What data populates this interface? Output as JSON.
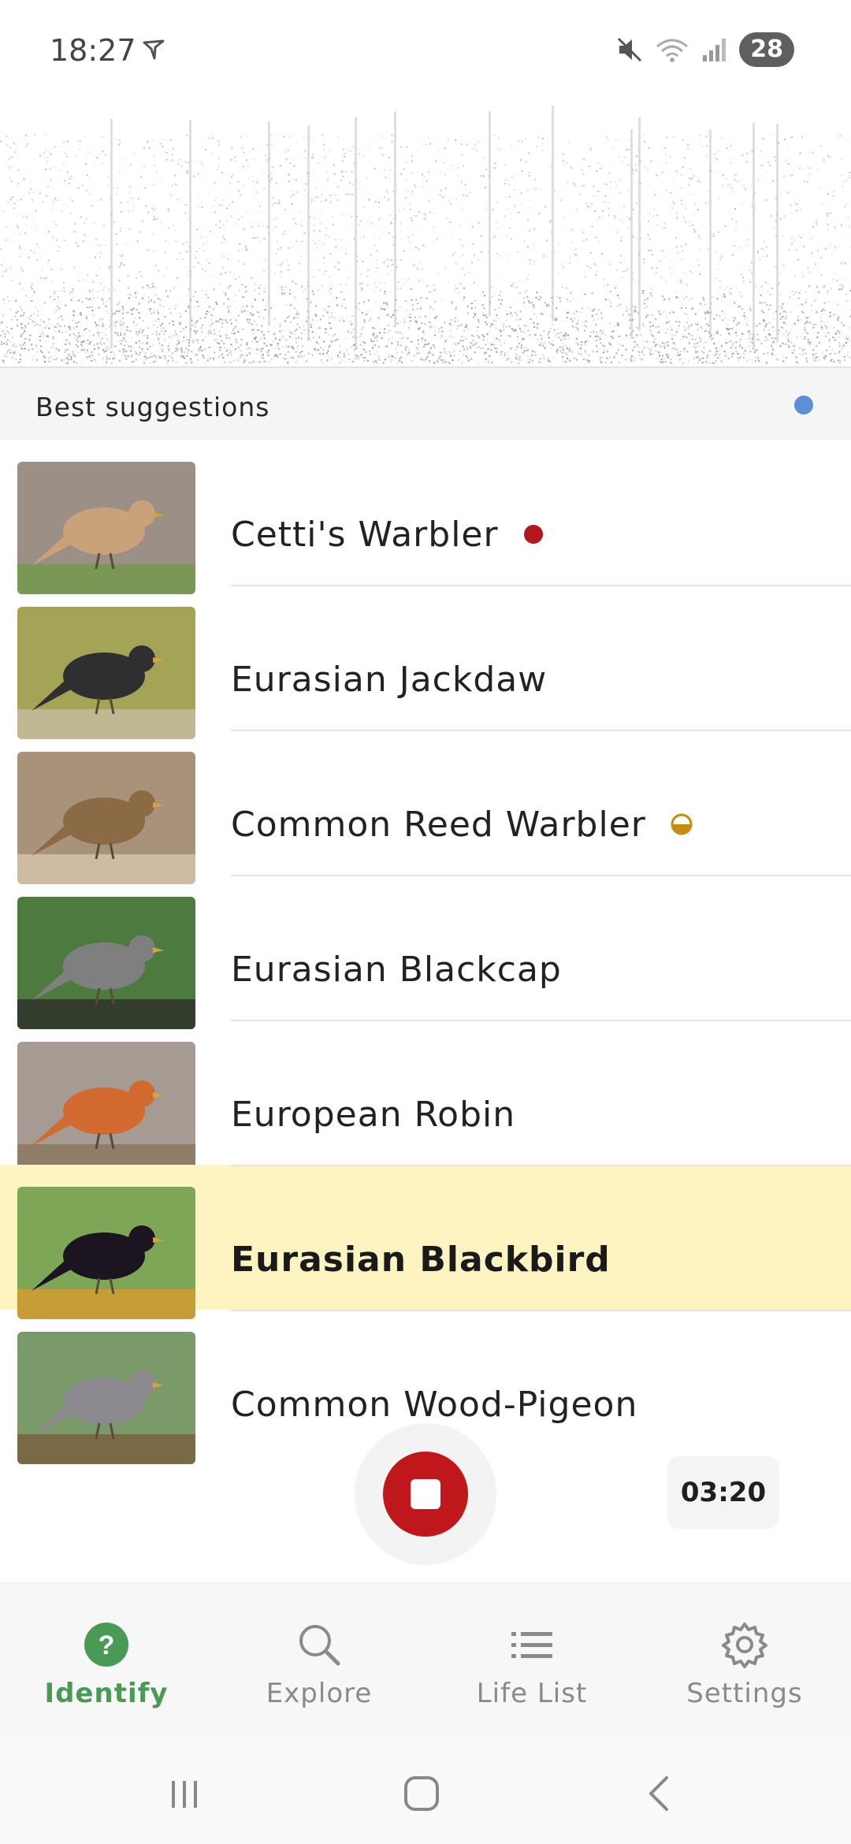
{
  "status_bar": {
    "time": "18:27",
    "battery": "28",
    "icons": [
      "navigation-arrow-icon",
      "mute-icon",
      "wifi-icon",
      "signal-icon"
    ]
  },
  "suggestions": {
    "header": "Best suggestions",
    "indicator_color": "#5b8fd6",
    "items": [
      {
        "name": "Cetti's Warbler",
        "badge": "red-dot",
        "highlighted": false
      },
      {
        "name": "Eurasian Jackdaw",
        "badge": "",
        "highlighted": false
      },
      {
        "name": "Common Reed Warbler",
        "badge": "half-circle-yellow",
        "highlighted": false
      },
      {
        "name": "Eurasian Blackcap",
        "badge": "",
        "highlighted": false
      },
      {
        "name": "European Robin",
        "badge": "",
        "highlighted": false
      },
      {
        "name": "Eurasian Blackbird",
        "badge": "",
        "highlighted": true
      },
      {
        "name": "Common Wood-Pigeon",
        "badge": "",
        "highlighted": false
      }
    ]
  },
  "recording": {
    "timer": "03:20",
    "button_color": "#c0171c"
  },
  "bottom_nav": {
    "items": [
      {
        "label": "Identify",
        "icon": "question-circle-icon",
        "active": true
      },
      {
        "label": "Explore",
        "icon": "search-icon",
        "active": false
      },
      {
        "label": "Life List",
        "icon": "list-icon",
        "active": false
      },
      {
        "label": "Settings",
        "icon": "gear-icon",
        "active": false
      }
    ],
    "active_color": "#4a9a56"
  },
  "system_nav": {
    "icons": [
      "recent-apps-icon",
      "home-icon",
      "back-icon"
    ]
  }
}
